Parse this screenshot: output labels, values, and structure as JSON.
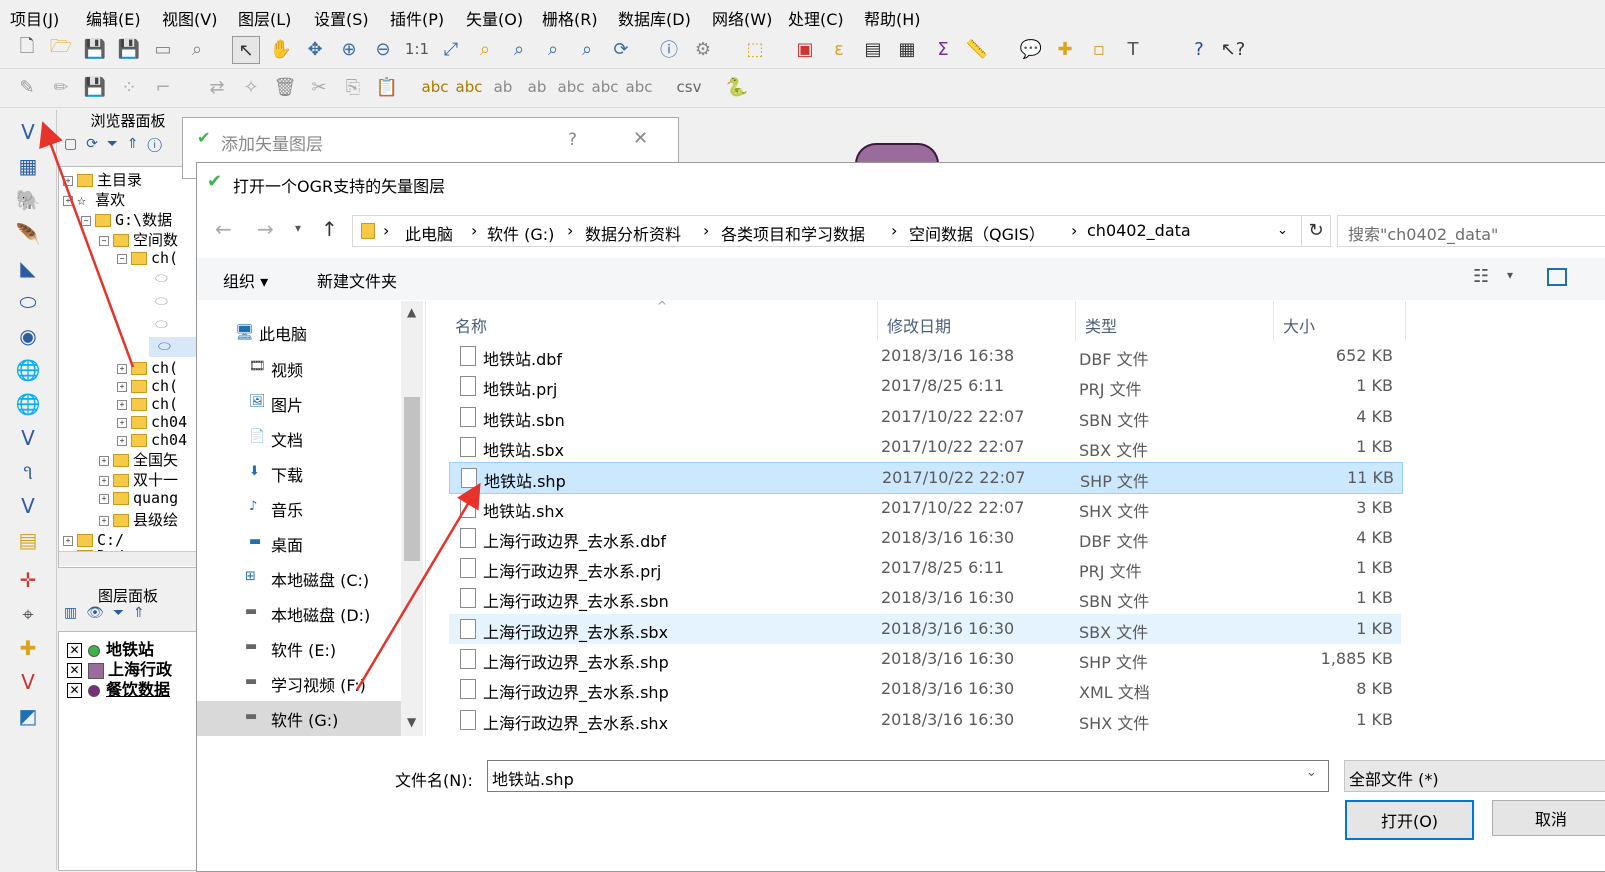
{
  "menu": [
    "项目(J)",
    "编辑(E)",
    "视图(V)",
    "图层(L)",
    "设置(S)",
    "插件(P)",
    "矢量(O)",
    "栅格(R)",
    "数据库(D)",
    "网络(W)",
    "处理(C)",
    "帮助(H)"
  ],
  "browser_panel": {
    "title": "浏览器面板",
    "items": [
      "主目录",
      "喜欢",
      "G:\\数据",
      "空间数",
      "ch(",
      "ch(",
      "ch(",
      "ch(",
      "ch04",
      "ch04",
      "全国矢",
      "双十一",
      "quang",
      "县级绘",
      "C:/",
      "D:/"
    ]
  },
  "layers_panel": {
    "title": "图层面板",
    "layers": [
      {
        "name": "地铁站",
        "symbol": "circle",
        "color": "#3cb44b"
      },
      {
        "name": "上海行政",
        "symbol": "square",
        "color": "#9c6b9e"
      },
      {
        "name": "餐饮数据",
        "symbol": "circle",
        "color": "#7a2e7a"
      }
    ]
  },
  "bg_dialog": {
    "title": "添加矢量图层",
    "help": "?",
    "close": "✕"
  },
  "dialog": {
    "title": "打开一个OGR支持的矢量图层",
    "breadcrumb": [
      "此电脑",
      "软件 (G:)",
      "数据分析资料",
      "各类项目和学习数据",
      "空间数据（QGIS）",
      "ch0402_data"
    ],
    "search_placeholder": "搜索\"ch0402_data\"",
    "organize": "组织 ▾",
    "new_folder": "新建文件夹",
    "nav_items": [
      "此电脑",
      "视频",
      "图片",
      "文档",
      "下载",
      "音乐",
      "桌面",
      "本地磁盘 (C:)",
      "本地磁盘 (D:)",
      "软件 (E:)",
      "学习视频 (F:)",
      "软件 (G:)"
    ],
    "columns": {
      "name": "名称",
      "date": "修改日期",
      "type": "类型",
      "size": "大小"
    },
    "files": [
      {
        "name": "地铁站.dbf",
        "date": "2018/3/16 16:38",
        "type": "DBF 文件",
        "size": "652 KB"
      },
      {
        "name": "地铁站.prj",
        "date": "2017/8/25 6:11",
        "type": "PRJ 文件",
        "size": "1 KB"
      },
      {
        "name": "地铁站.sbn",
        "date": "2017/10/22 22:07",
        "type": "SBN 文件",
        "size": "4 KB"
      },
      {
        "name": "地铁站.sbx",
        "date": "2017/10/22 22:07",
        "type": "SBX 文件",
        "size": "1 KB"
      },
      {
        "name": "地铁站.shp",
        "date": "2017/10/22 22:07",
        "type": "SHP 文件",
        "size": "11 KB"
      },
      {
        "name": "地铁站.shx",
        "date": "2017/10/22 22:07",
        "type": "SHX 文件",
        "size": "3 KB"
      },
      {
        "name": "上海行政边界_去水系.dbf",
        "date": "2018/3/16 16:30",
        "type": "DBF 文件",
        "size": "4 KB"
      },
      {
        "name": "上海行政边界_去水系.prj",
        "date": "2017/8/25 6:11",
        "type": "PRJ 文件",
        "size": "1 KB"
      },
      {
        "name": "上海行政边界_去水系.sbn",
        "date": "2018/3/16 16:30",
        "type": "SBN 文件",
        "size": "1 KB"
      },
      {
        "name": "上海行政边界_去水系.sbx",
        "date": "2018/3/16 16:30",
        "type": "SBX 文件",
        "size": "1 KB"
      },
      {
        "name": "上海行政边界_去水系.shp",
        "date": "2018/3/16 16:30",
        "type": "SHP 文件",
        "size": "1,885 KB"
      },
      {
        "name": "上海行政边界_去水系.shp",
        "date": "2018/3/16 16:30",
        "type": "XML 文档",
        "size": "8 KB"
      },
      {
        "name": "上海行政边界_去水系.shx",
        "date": "2018/3/16 16:30",
        "type": "SHX 文件",
        "size": "1 KB"
      }
    ],
    "selected_index": 4,
    "hover_index": 9,
    "filename_label": "文件名(N):",
    "filename_value": "地铁站.shp",
    "filetype_value": "全部文件 (*)",
    "open_label": "打开(O)",
    "cancel_label": "取消"
  },
  "colors": {
    "selection": "#cce8ff",
    "accent": "#0078d7",
    "arrow": "#e8332a"
  }
}
